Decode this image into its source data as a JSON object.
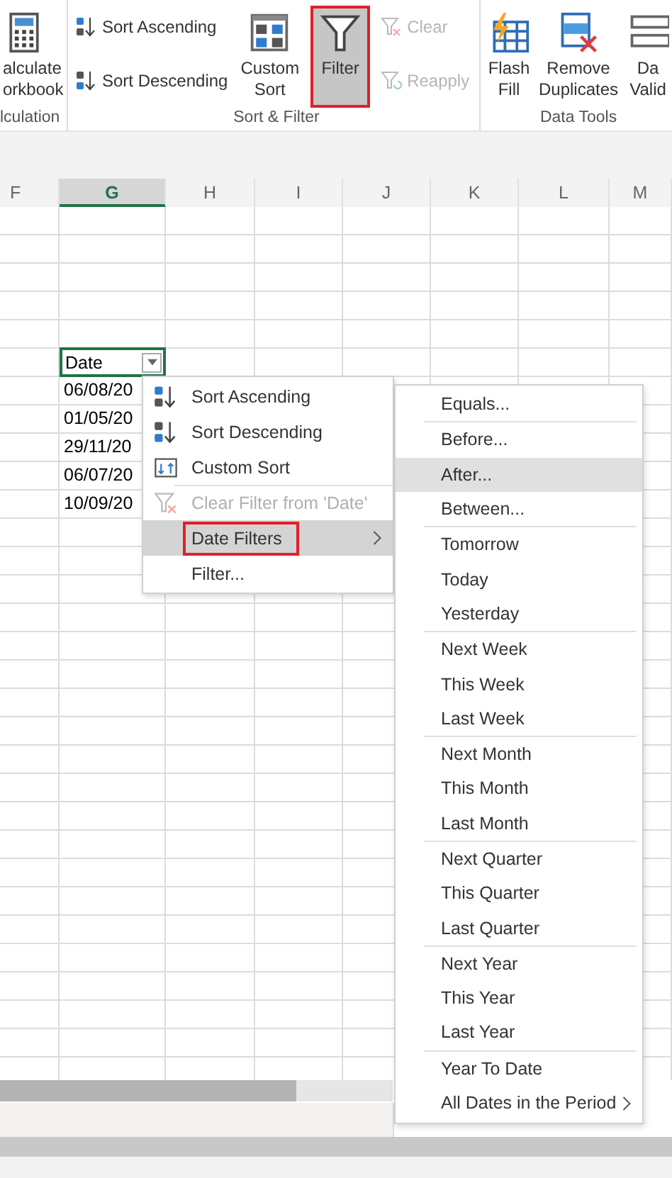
{
  "ribbon": {
    "groups": [
      {
        "label": "lculation",
        "columns": [
          [
            {
              "kind": "large",
              "lines": [
                "alculate",
                "orkbook"
              ],
              "on": false,
              "disabled": false,
              "highlighted": false
            }
          ]
        ]
      },
      {
        "label": "Sort & Filter",
        "columns": [
          [
            {
              "kind": "small",
              "lines": [
                "Sort Ascending"
              ],
              "on": false,
              "disabled": false,
              "highlighted": false
            },
            {
              "kind": "small",
              "lines": [
                "Sort Descending"
              ],
              "on": false,
              "disabled": false,
              "highlighted": false
            }
          ],
          [
            {
              "kind": "large",
              "lines": [
                "Custom",
                "Sort"
              ],
              "on": false,
              "disabled": false,
              "highlighted": false
            }
          ],
          [
            {
              "kind": "large",
              "lines": [
                "Filter"
              ],
              "on": true,
              "disabled": false,
              "highlighted": true
            }
          ],
          [
            {
              "kind": "small",
              "lines": [
                "Clear"
              ],
              "on": false,
              "disabled": true,
              "highlighted": false
            },
            {
              "kind": "small",
              "lines": [
                "Reapply"
              ],
              "on": false,
              "disabled": true,
              "highlighted": false
            }
          ]
        ]
      },
      {
        "label": "Data Tools",
        "columns": [
          [
            {
              "kind": "large",
              "lines": [
                "Flash",
                "Fill"
              ],
              "on": false,
              "disabled": false,
              "highlighted": false
            }
          ],
          [
            {
              "kind": "large",
              "lines": [
                "Remove",
                "Duplicates"
              ],
              "on": false,
              "disabled": false,
              "highlighted": false
            }
          ],
          [
            {
              "kind": "large",
              "lines": [
                "Da",
                "Valid"
              ],
              "on": false,
              "disabled": false,
              "highlighted": false
            }
          ]
        ]
      }
    ]
  },
  "sheet": {
    "columns": [
      {
        "label": "F",
        "selected": false
      },
      {
        "label": "G",
        "selected": true
      },
      {
        "label": "H",
        "selected": false
      },
      {
        "label": "I",
        "selected": false
      },
      {
        "label": "J",
        "selected": false
      },
      {
        "label": "K",
        "selected": false
      },
      {
        "label": "L",
        "selected": false
      },
      {
        "label": "M",
        "selected": false
      }
    ],
    "header_cell": {
      "text": "Date",
      "active": true
    },
    "cells": [
      "06/08/20",
      "01/05/20",
      "29/11/20",
      "06/07/20",
      "10/09/20"
    ]
  },
  "filter_menu": {
    "items": [
      {
        "label": "Sort Ascending",
        "disabled": false,
        "selected": false,
        "highlighted": false,
        "submenu": false,
        "separator_before": false
      },
      {
        "label": "Sort Descending",
        "disabled": false,
        "selected": false,
        "highlighted": false,
        "submenu": false,
        "separator_before": false
      },
      {
        "label": "Custom Sort",
        "disabled": false,
        "selected": false,
        "highlighted": false,
        "submenu": false,
        "separator_before": false
      },
      {
        "label": "Clear Filter from 'Date'",
        "disabled": true,
        "selected": false,
        "highlighted": false,
        "submenu": false,
        "separator_before": true
      },
      {
        "label": "Date Filters",
        "disabled": false,
        "selected": true,
        "highlighted": true,
        "submenu": true,
        "separator_before": false
      },
      {
        "label": "Filter...",
        "disabled": false,
        "selected": false,
        "highlighted": false,
        "submenu": false,
        "separator_before": false
      }
    ]
  },
  "date_filters_menu": {
    "groups": [
      [
        {
          "label": "Equals...",
          "selected": false,
          "submenu": false
        }
      ],
      [
        {
          "label": "Before...",
          "selected": false,
          "submenu": false
        },
        {
          "label": "After...",
          "selected": true,
          "submenu": false
        },
        {
          "label": "Between...",
          "selected": false,
          "submenu": false
        }
      ],
      [
        {
          "label": "Tomorrow",
          "selected": false,
          "submenu": false
        },
        {
          "label": "Today",
          "selected": false,
          "submenu": false
        },
        {
          "label": "Yesterday",
          "selected": false,
          "submenu": false
        }
      ],
      [
        {
          "label": "Next Week",
          "selected": false,
          "submenu": false
        },
        {
          "label": "This Week",
          "selected": false,
          "submenu": false
        },
        {
          "label": "Last Week",
          "selected": false,
          "submenu": false
        }
      ],
      [
        {
          "label": "Next Month",
          "selected": false,
          "submenu": false
        },
        {
          "label": "This Month",
          "selected": false,
          "submenu": false
        },
        {
          "label": "Last Month",
          "selected": false,
          "submenu": false
        }
      ],
      [
        {
          "label": "Next Quarter",
          "selected": false,
          "submenu": false
        },
        {
          "label": "This Quarter",
          "selected": false,
          "submenu": false
        },
        {
          "label": "Last Quarter",
          "selected": false,
          "submenu": false
        }
      ],
      [
        {
          "label": "Next Year",
          "selected": false,
          "submenu": false
        },
        {
          "label": "This Year",
          "selected": false,
          "submenu": false
        },
        {
          "label": "Last Year",
          "selected": false,
          "submenu": false
        }
      ],
      [
        {
          "label": "Year To Date",
          "selected": false,
          "submenu": false
        },
        {
          "label": "All Dates in the Period",
          "selected": false,
          "submenu": true
        }
      ]
    ]
  }
}
